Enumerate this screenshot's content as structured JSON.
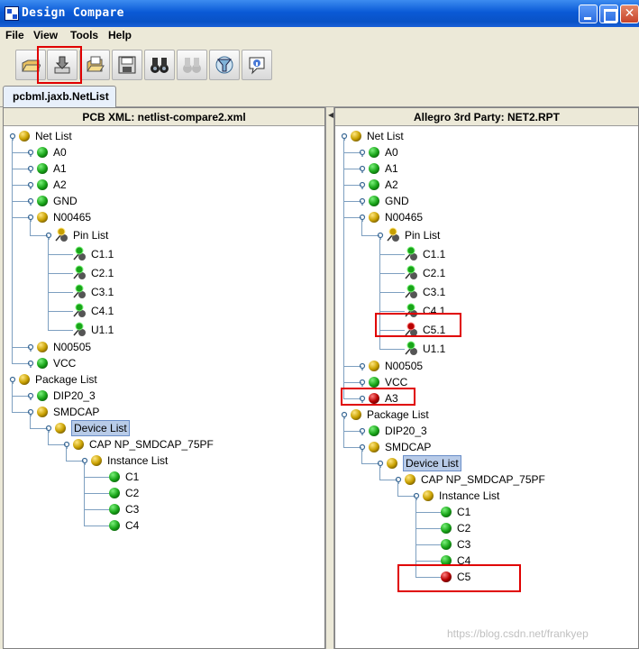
{
  "window": {
    "title": "Design Compare"
  },
  "menu": [
    "File",
    "View",
    "Tools",
    "Help"
  ],
  "toolbar": [
    {
      "name": "open-folder-icon"
    },
    {
      "name": "import-icon"
    },
    {
      "name": "open-multi-icon"
    },
    {
      "name": "save-icon"
    },
    {
      "name": "binoculars-icon"
    },
    {
      "name": "binoculars-disabled-icon"
    },
    {
      "name": "filter-icon"
    },
    {
      "name": "info-icon"
    }
  ],
  "tab": {
    "label": "pcbml.jaxb.NetList"
  },
  "left_panel": {
    "header": "PCB XML: netlist-compare2.xml",
    "nodes": [
      {
        "label": "Net List",
        "icon": "gold",
        "level": 0,
        "toggle": true
      },
      {
        "label": "A0",
        "icon": "green",
        "level": 1,
        "toggle": true
      },
      {
        "label": "A1",
        "icon": "green",
        "level": 1,
        "toggle": true
      },
      {
        "label": "A2",
        "icon": "green",
        "level": 1,
        "toggle": true
      },
      {
        "label": "GND",
        "icon": "green",
        "level": 1,
        "toggle": true
      },
      {
        "label": "N00465",
        "icon": "gold",
        "level": 1,
        "toggle": true
      },
      {
        "label": "Pin List",
        "icon": "pin-gold",
        "level": 2,
        "toggle": true
      },
      {
        "label": "C1.1",
        "icon": "pin-green",
        "level": 3
      },
      {
        "label": "C2.1",
        "icon": "pin-green",
        "level": 3
      },
      {
        "label": "C3.1",
        "icon": "pin-green",
        "level": 3
      },
      {
        "label": "C4.1",
        "icon": "pin-green",
        "level": 3
      },
      {
        "label": "U1.1",
        "icon": "pin-green",
        "level": 3
      },
      {
        "label": "N00505",
        "icon": "gold",
        "level": 1,
        "toggle": true
      },
      {
        "label": "VCC",
        "icon": "green",
        "level": 1,
        "toggle": true
      },
      {
        "label": "Package List",
        "icon": "gold",
        "level": 0,
        "toggle": true
      },
      {
        "label": "DIP20_3",
        "icon": "green",
        "level": 1,
        "toggle": true
      },
      {
        "label": "SMDCAP",
        "icon": "gold",
        "level": 1,
        "toggle": true
      },
      {
        "label": "Device List",
        "icon": "gold",
        "level": 2,
        "toggle": true,
        "selected": true
      },
      {
        "label": "CAP NP_SMDCAP_75PF",
        "icon": "gold",
        "level": 3,
        "toggle": true
      },
      {
        "label": "Instance List",
        "icon": "gold",
        "level": 4,
        "toggle": true
      },
      {
        "label": "C1",
        "icon": "green",
        "level": 5
      },
      {
        "label": "C2",
        "icon": "green",
        "level": 5
      },
      {
        "label": "C3",
        "icon": "green",
        "level": 5
      },
      {
        "label": "C4",
        "icon": "green",
        "level": 5
      }
    ]
  },
  "right_panel": {
    "header": "Allegro 3rd Party: NET2.RPT",
    "nodes": [
      {
        "label": "Net List",
        "icon": "gold",
        "level": 0,
        "toggle": true
      },
      {
        "label": "A0",
        "icon": "green",
        "level": 1,
        "toggle": true
      },
      {
        "label": "A1",
        "icon": "green",
        "level": 1,
        "toggle": true
      },
      {
        "label": "A2",
        "icon": "green",
        "level": 1,
        "toggle": true
      },
      {
        "label": "GND",
        "icon": "green",
        "level": 1,
        "toggle": true
      },
      {
        "label": "N00465",
        "icon": "gold",
        "level": 1,
        "toggle": true
      },
      {
        "label": "Pin List",
        "icon": "pin-gold",
        "level": 2,
        "toggle": true
      },
      {
        "label": "C1.1",
        "icon": "pin-green",
        "level": 3
      },
      {
        "label": "C2.1",
        "icon": "pin-green",
        "level": 3
      },
      {
        "label": "C3.1",
        "icon": "pin-green",
        "level": 3
      },
      {
        "label": "C4.1",
        "icon": "pin-green",
        "level": 3
      },
      {
        "label": "C5.1",
        "icon": "pin-red",
        "level": 3,
        "flagged": true
      },
      {
        "label": "U1.1",
        "icon": "pin-green",
        "level": 3
      },
      {
        "label": "N00505",
        "icon": "gold",
        "level": 1,
        "toggle": true
      },
      {
        "label": "VCC",
        "icon": "green",
        "level": 1,
        "toggle": true
      },
      {
        "label": "A3",
        "icon": "red",
        "level": 1,
        "toggle": true,
        "flagged": true
      },
      {
        "label": "Package List",
        "icon": "gold",
        "level": 0,
        "toggle": true
      },
      {
        "label": "DIP20_3",
        "icon": "green",
        "level": 1,
        "toggle": true
      },
      {
        "label": "SMDCAP",
        "icon": "gold",
        "level": 1,
        "toggle": true
      },
      {
        "label": "Device List",
        "icon": "gold",
        "level": 2,
        "toggle": true,
        "selected": true
      },
      {
        "label": "CAP NP_SMDCAP_75PF",
        "icon": "gold",
        "level": 3,
        "toggle": true
      },
      {
        "label": "Instance List",
        "icon": "gold",
        "level": 4,
        "toggle": true
      },
      {
        "label": "C1",
        "icon": "green",
        "level": 5
      },
      {
        "label": "C2",
        "icon": "green",
        "level": 5
      },
      {
        "label": "C3",
        "icon": "green",
        "level": 5
      },
      {
        "label": "C4",
        "icon": "green",
        "level": 5
      },
      {
        "label": "C5",
        "icon": "red",
        "level": 5,
        "flagged": true
      }
    ]
  },
  "watermark": "https://blog.csdn.net/frankyep",
  "colors": {
    "match_green": "#1fa51f",
    "partial_gold": "#c8a000",
    "missing_red": "#b80000",
    "highlight_red": "#e00000"
  }
}
